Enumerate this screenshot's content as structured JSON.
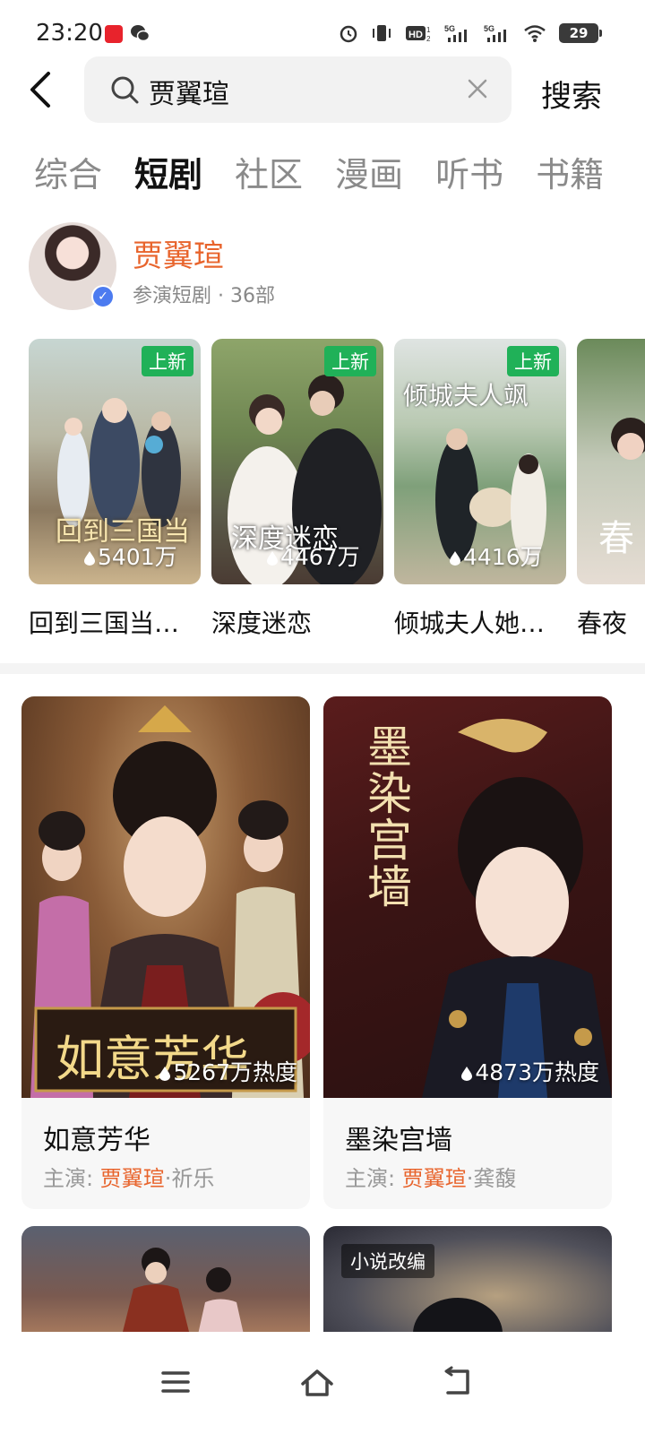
{
  "status_bar": {
    "time": "23:20",
    "battery": "29",
    "icons": [
      "alarm-icon",
      "vibrate-icon",
      "hd-icon",
      "signal-5g-icon",
      "signal-5g-icon",
      "wifi-icon",
      "battery-icon"
    ]
  },
  "search": {
    "query": "贾翼瑄",
    "button_label": "搜索"
  },
  "tabs": [
    {
      "label": "综合",
      "active": false
    },
    {
      "label": "短剧",
      "active": true
    },
    {
      "label": "社区",
      "active": false
    },
    {
      "label": "漫画",
      "active": false
    },
    {
      "label": "听书",
      "active": false
    },
    {
      "label": "书籍",
      "active": false
    }
  ],
  "actor": {
    "name": "贾翼瑄",
    "meta": "参演短剧 · 36部"
  },
  "dramas_row": [
    {
      "title": "回到三国当…",
      "heat": "5401万",
      "badge": "上新",
      "poster_text": "回到三国当"
    },
    {
      "title": "深度迷恋",
      "heat": "4467万",
      "badge": "上新",
      "poster_text": "深度迷恋"
    },
    {
      "title": "倾城夫人她…",
      "heat": "4416万",
      "badge": "上新",
      "poster_text": "倾城夫人飒"
    },
    {
      "title": "春夜",
      "heat": "",
      "badge": "",
      "poster_text": "春"
    }
  ],
  "feed": [
    {
      "title": "如意芳华",
      "heat": "5267万热度",
      "cast_label": "主演:",
      "lead": "贾翼瑄",
      "co": "·祈乐",
      "poster_text": "如意芳华"
    },
    {
      "title": "墨染宫墙",
      "heat": "4873万热度",
      "cast_label": "主演:",
      "lead": "贾翼瑄",
      "co": "·龚馥",
      "poster_text": "墨染宫墙"
    }
  ],
  "partial": {
    "badge": "小说改编"
  },
  "colors": {
    "accent": "#e8642c",
    "badge_new": "#20b158",
    "verified": "#4c7bf0"
  }
}
